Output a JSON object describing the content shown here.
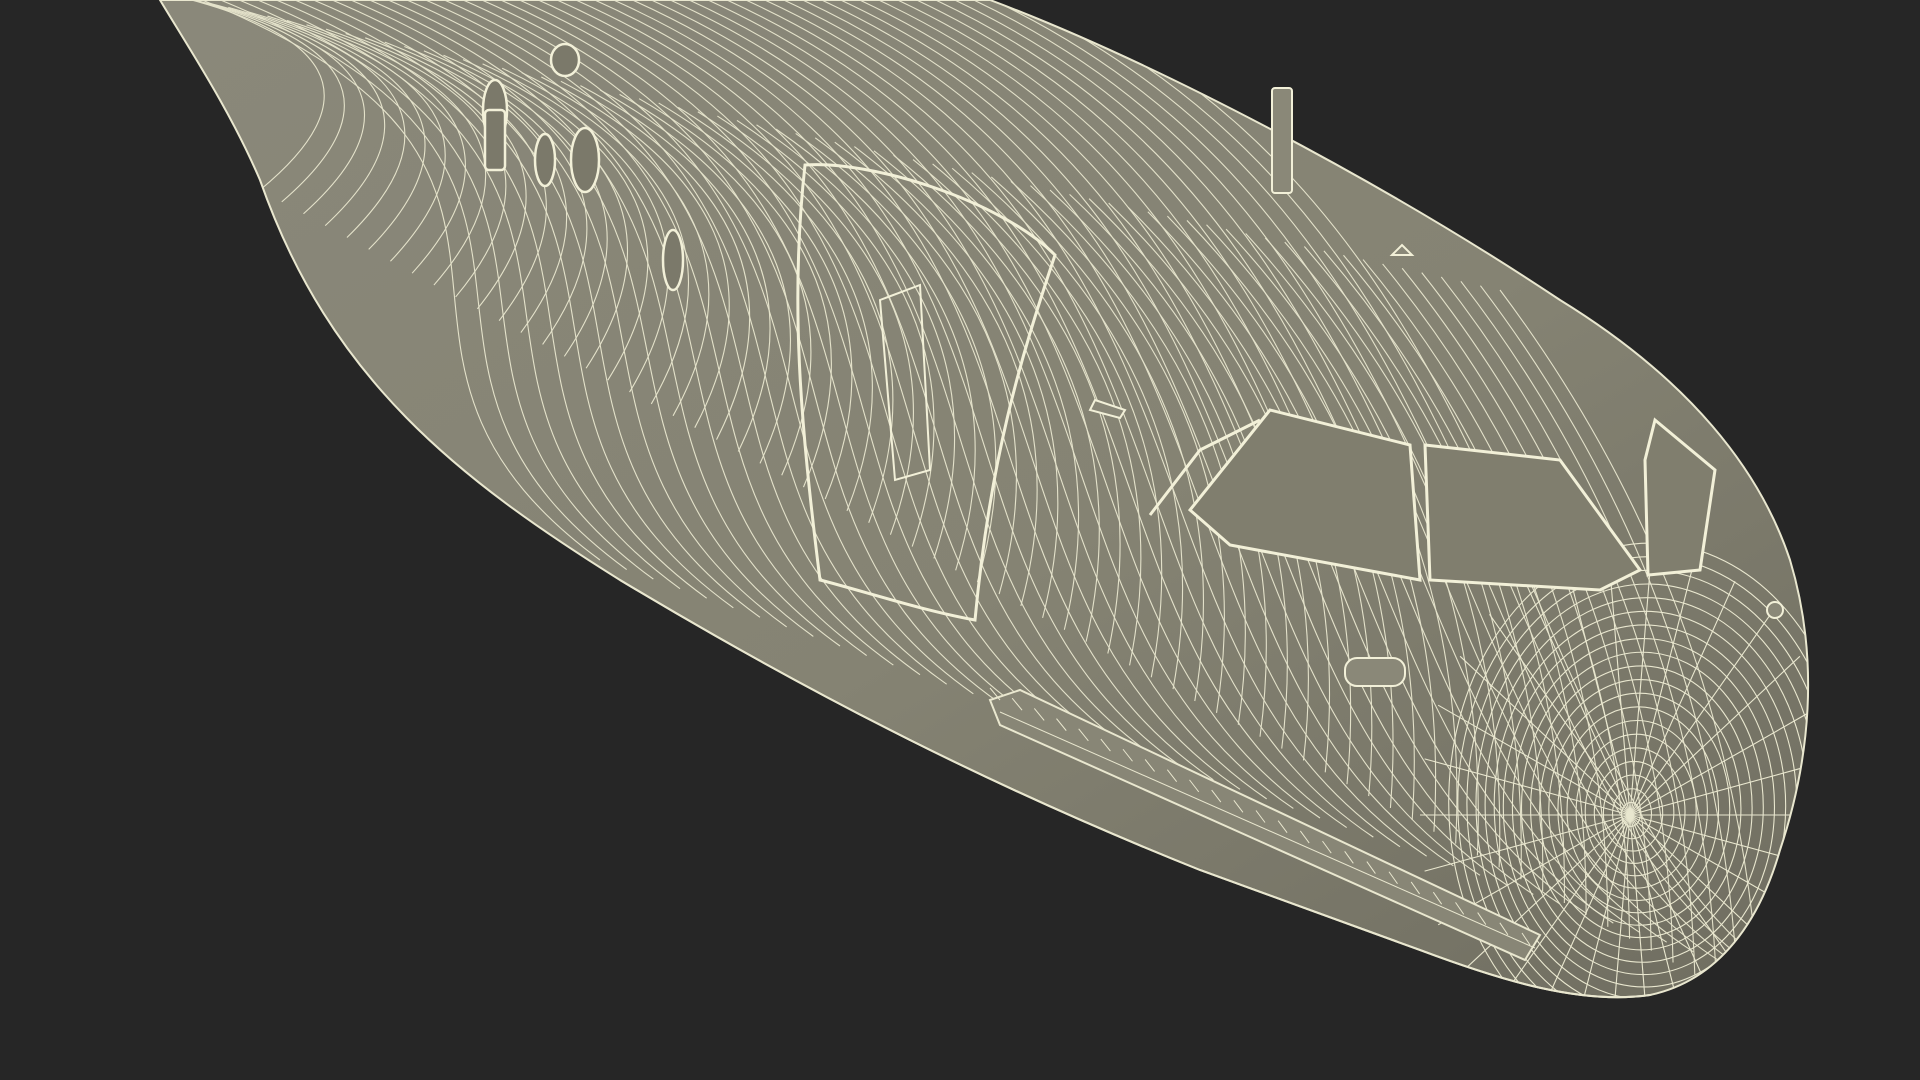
{
  "scene": {
    "subject": "aircraft-fuselage-wireframe",
    "colors": {
      "background": "#262626",
      "surface": "#858373",
      "surface_light": "#93917f",
      "surface_dark": "#6f6d60",
      "wire": "#e9e7cf",
      "glass": "#7d7b6b"
    }
  }
}
